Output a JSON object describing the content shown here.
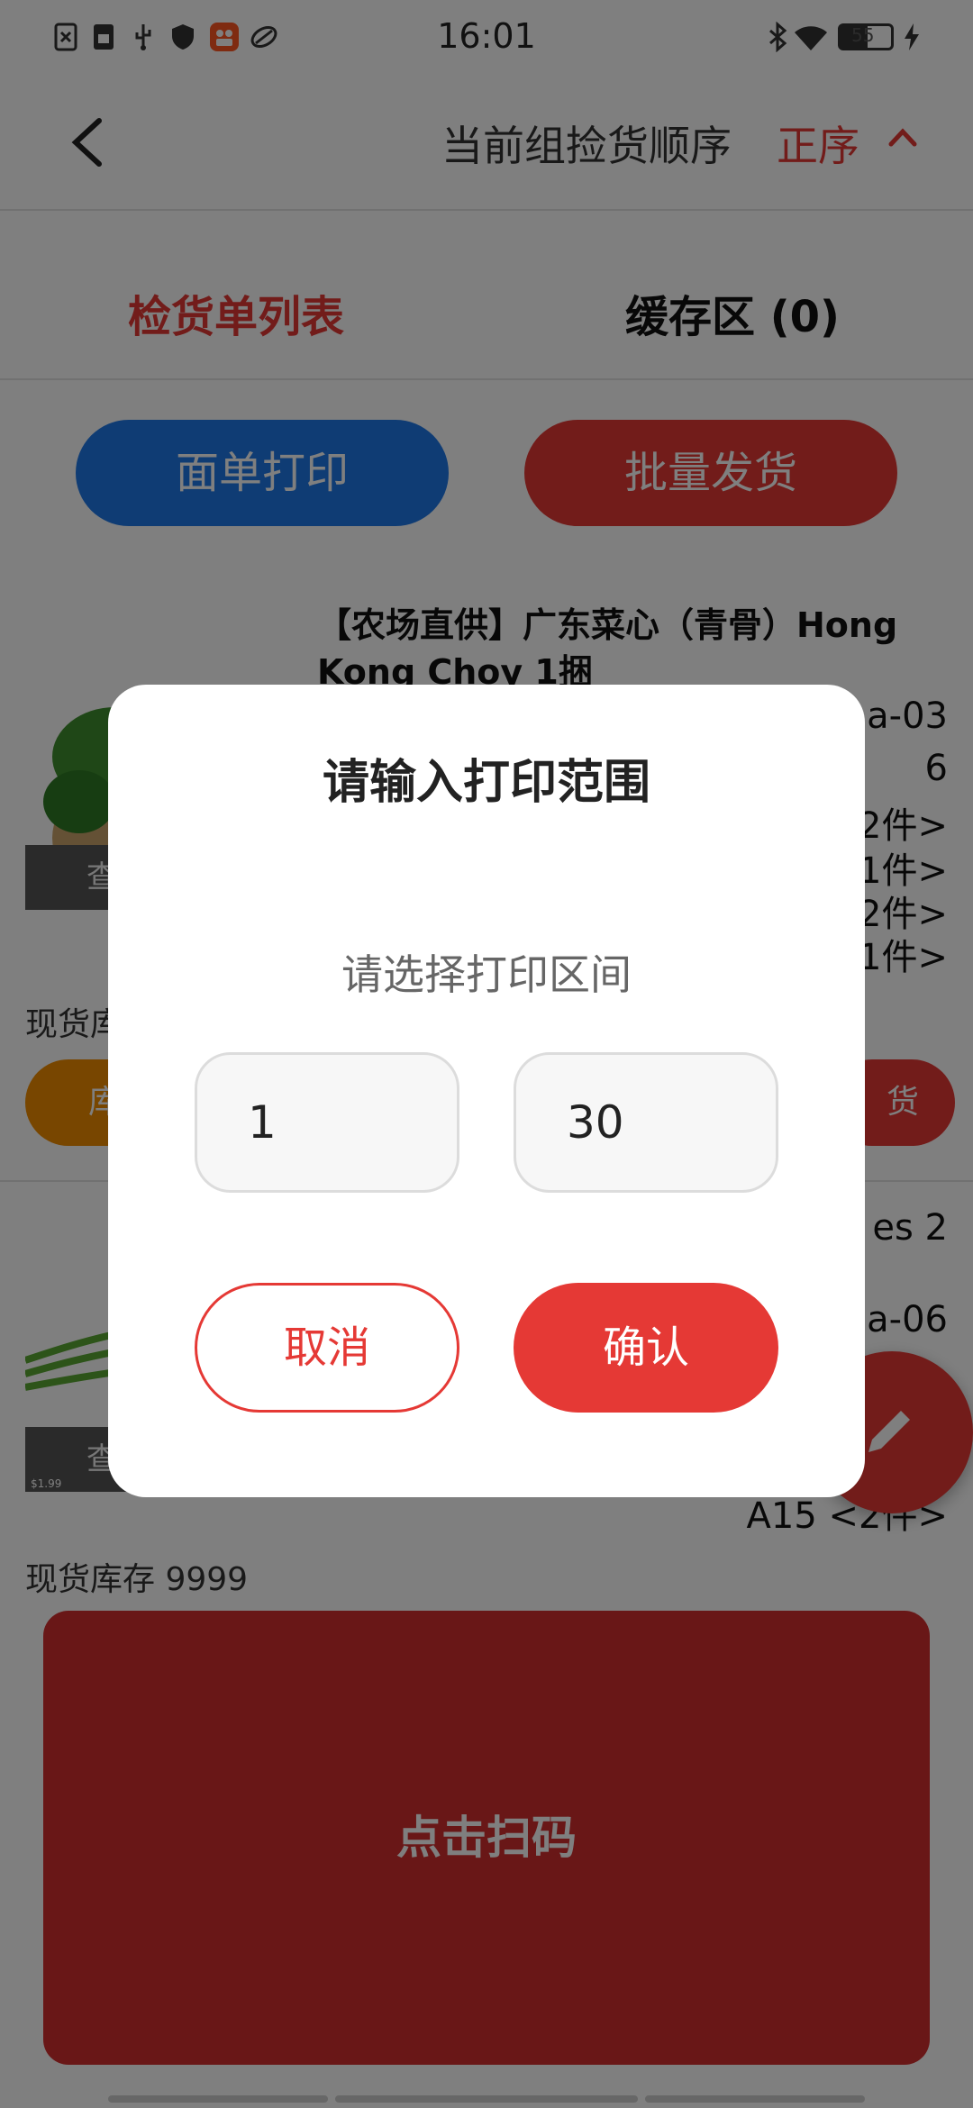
{
  "status_bar": {
    "time": "16:01",
    "battery": "55"
  },
  "header": {
    "sort_label": "当前组捡货顺序",
    "sort_value": "正序"
  },
  "tabs": [
    {
      "label": "检货单列表"
    },
    {
      "label": "缓存区 (0)"
    }
  ],
  "actions": {
    "print_label": "面单打印",
    "batch_ship_label": "批量发货"
  },
  "product1": {
    "title": "【农场直供】广东菜心（青骨）Hong Kong Choy 1捆",
    "look_label": "查",
    "right_lines": [
      "a-03",
      "6",
      "2件>",
      "<1件>",
      "2件>",
      "<1件>"
    ],
    "stock_label": "现货库",
    "stock_btn": "库",
    "ship_btn": "货"
  },
  "product2": {
    "right_lines": [
      "es 2",
      "a-06",
      "A15   <2件>"
    ],
    "look_label": "查",
    "price_tag": "$1.99",
    "stock_label": "现货库存 9999"
  },
  "scan": {
    "label": "点击扫码"
  },
  "dialog": {
    "title": "请输入打印范围",
    "subtitle": "请选择打印区间",
    "range_start": "1",
    "range_end": "30",
    "cancel_label": "取消",
    "confirm_label": "确认"
  },
  "colors": {
    "accent_red": "#e53935",
    "accent_blue": "#1e78e8",
    "accent_orange": "#f08c00"
  }
}
